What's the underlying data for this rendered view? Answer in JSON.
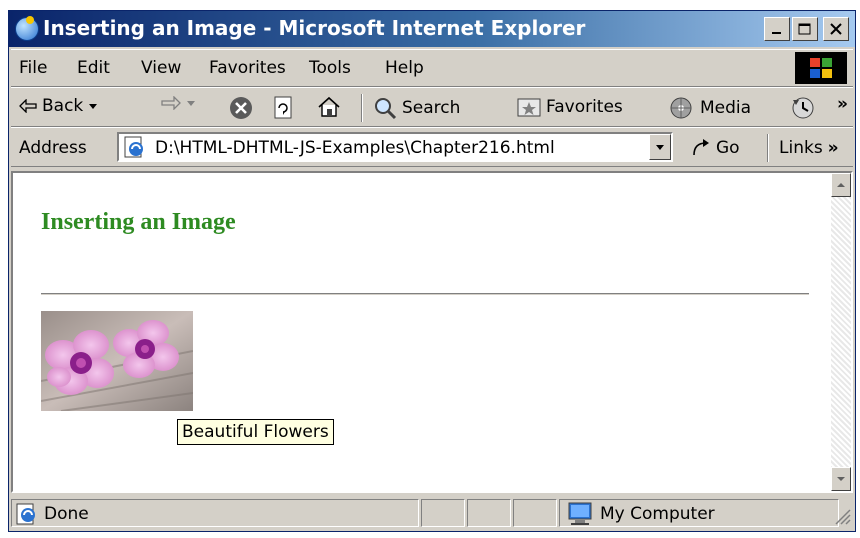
{
  "window": {
    "title": "Inserting an Image - Microsoft Internet Explorer"
  },
  "menu": {
    "items": [
      "File",
      "Edit",
      "View",
      "Favorites",
      "Tools",
      "Help"
    ]
  },
  "toolbar": {
    "back": "Back",
    "search": "Search",
    "favorites": "Favorites",
    "media": "Media"
  },
  "address": {
    "label": "Address",
    "url": "D:\\HTML-DHTML-JS-Examples\\Chapter216.html",
    "go": "Go",
    "links": "Links"
  },
  "page": {
    "heading": "Inserting an Image",
    "image_tooltip": "Beautiful Flowers"
  },
  "status": {
    "text": "Done",
    "zone": "My Computer"
  },
  "colors": {
    "heading": "#2e8b22",
    "titlebar_start": "#0a246a",
    "titlebar_end": "#a6caf0",
    "tooltip_bg": "#ffffe1"
  }
}
